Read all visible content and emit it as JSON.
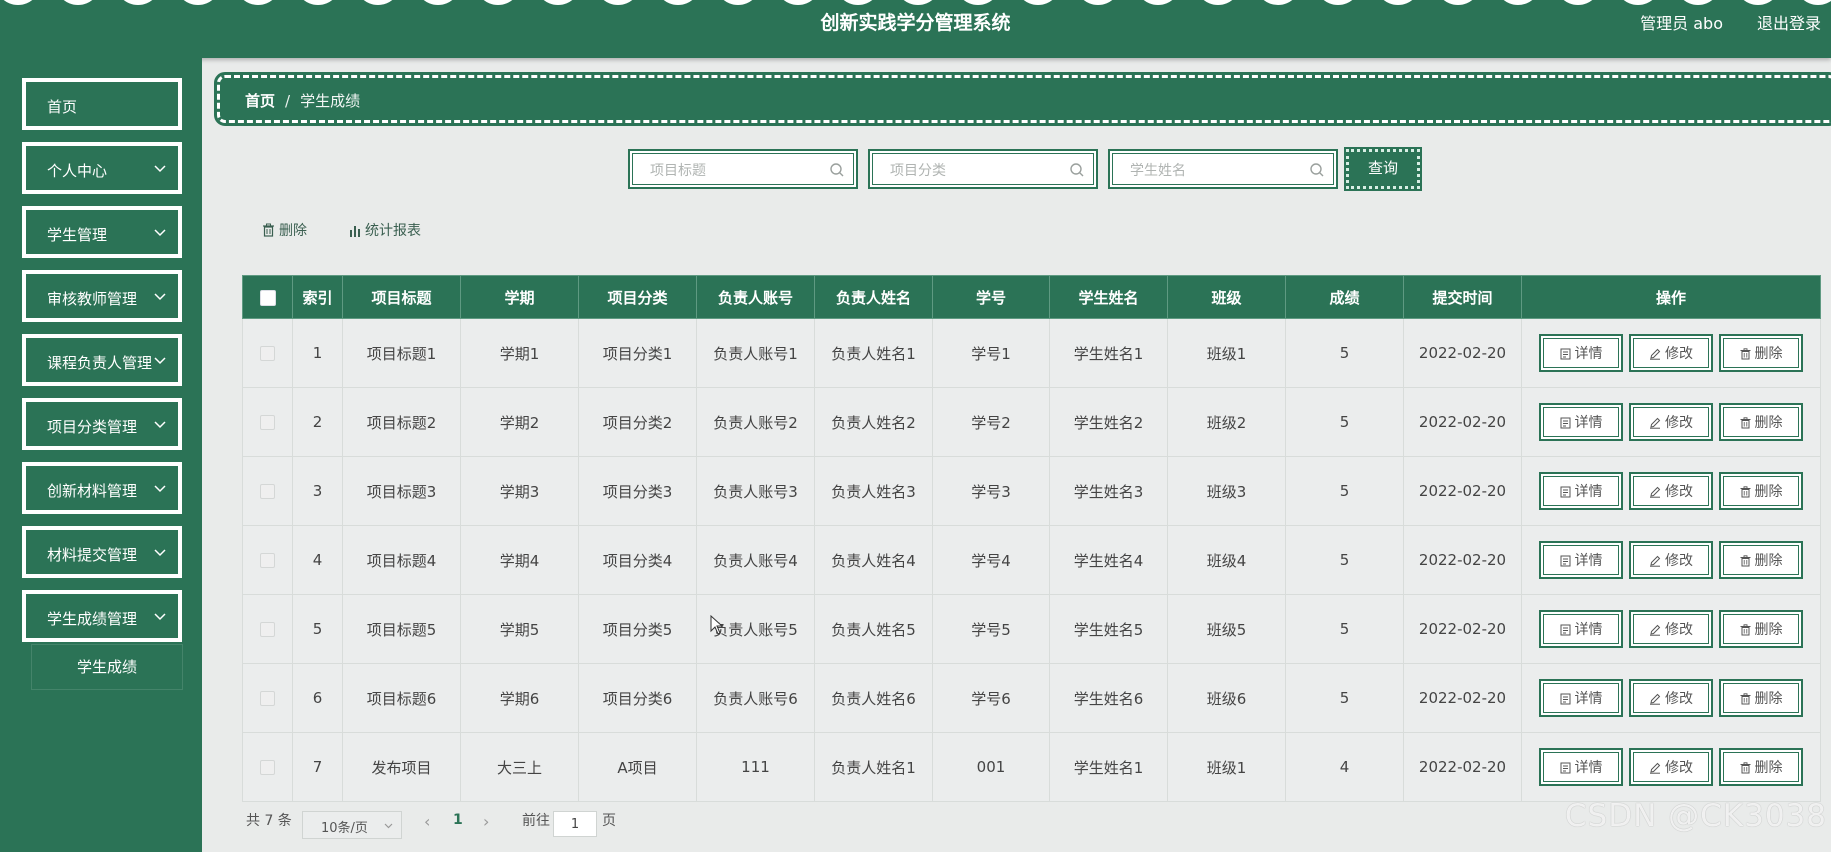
{
  "header": {
    "title": "创新实践学分管理系统",
    "admin_label": "管理员 abo",
    "logout_label": "退出登录"
  },
  "sidebar": {
    "items": [
      {
        "label": "首页",
        "has_arrow": false
      },
      {
        "label": "个人中心",
        "has_arrow": true
      },
      {
        "label": "学生管理",
        "has_arrow": true
      },
      {
        "label": "审核教师管理",
        "has_arrow": true
      },
      {
        "label": "课程负责人管理",
        "has_arrow": true
      },
      {
        "label": "项目分类管理",
        "has_arrow": true
      },
      {
        "label": "创新材料管理",
        "has_arrow": true
      },
      {
        "label": "材料提交管理",
        "has_arrow": true
      },
      {
        "label": "学生成绩管理",
        "has_arrow": true
      }
    ],
    "sub_item": "学生成绩"
  },
  "breadcrumb": {
    "home": "首页",
    "separator": "/",
    "current": "学生成绩"
  },
  "search": {
    "title_placeholder": "项目标题",
    "category_placeholder": "项目分类",
    "student_placeholder": "学生姓名",
    "query_label": "查询"
  },
  "toolbar": {
    "delete_label": "删除",
    "report_label": "统计报表"
  },
  "table": {
    "headers": [
      "",
      "索引",
      "项目标题",
      "学期",
      "项目分类",
      "负责人账号",
      "负责人姓名",
      "学号",
      "学生姓名",
      "班级",
      "成绩",
      "提交时间",
      "操作"
    ],
    "rows": [
      {
        "index": "1",
        "title": "项目标题1",
        "term": "学期1",
        "category": "项目分类1",
        "lead_account": "负责人账号1",
        "lead_name": "负责人姓名1",
        "student_id": "学号1",
        "student_name": "学生姓名1",
        "class": "班级1",
        "score": "5",
        "time": "2022-02-20"
      },
      {
        "index": "2",
        "title": "项目标题2",
        "term": "学期2",
        "category": "项目分类2",
        "lead_account": "负责人账号2",
        "lead_name": "负责人姓名2",
        "student_id": "学号2",
        "student_name": "学生姓名2",
        "class": "班级2",
        "score": "5",
        "time": "2022-02-20"
      },
      {
        "index": "3",
        "title": "项目标题3",
        "term": "学期3",
        "category": "项目分类3",
        "lead_account": "负责人账号3",
        "lead_name": "负责人姓名3",
        "student_id": "学号3",
        "student_name": "学生姓名3",
        "class": "班级3",
        "score": "5",
        "time": "2022-02-20"
      },
      {
        "index": "4",
        "title": "项目标题4",
        "term": "学期4",
        "category": "项目分类4",
        "lead_account": "负责人账号4",
        "lead_name": "负责人姓名4",
        "student_id": "学号4",
        "student_name": "学生姓名4",
        "class": "班级4",
        "score": "5",
        "time": "2022-02-20"
      },
      {
        "index": "5",
        "title": "项目标题5",
        "term": "学期5",
        "category": "项目分类5",
        "lead_account": "负责人账号5",
        "lead_name": "负责人姓名5",
        "student_id": "学号5",
        "student_name": "学生姓名5",
        "class": "班级5",
        "score": "5",
        "time": "2022-02-20"
      },
      {
        "index": "6",
        "title": "项目标题6",
        "term": "学期6",
        "category": "项目分类6",
        "lead_account": "负责人账号6",
        "lead_name": "负责人姓名6",
        "student_id": "学号6",
        "student_name": "学生姓名6",
        "class": "班级6",
        "score": "5",
        "time": "2022-02-20"
      },
      {
        "index": "7",
        "title": "发布项目",
        "term": "大三上",
        "category": "A项目",
        "lead_account": "111",
        "lead_name": "负责人姓名1",
        "student_id": "001",
        "student_name": "学生姓名1",
        "class": "班级1",
        "score": "4",
        "time": "2022-02-20"
      }
    ],
    "actions": {
      "detail": "详情",
      "edit": "修改",
      "delete": "删除"
    }
  },
  "pagination": {
    "total": "共 7 条",
    "page_size": "10条/页",
    "current_page": "1",
    "goto_prefix": "前往",
    "goto_value": "1",
    "goto_suffix": "页"
  },
  "watermark": "CSDN @CK3038",
  "colors": {
    "primary": "#2b7356",
    "background": "#e9ebea"
  }
}
